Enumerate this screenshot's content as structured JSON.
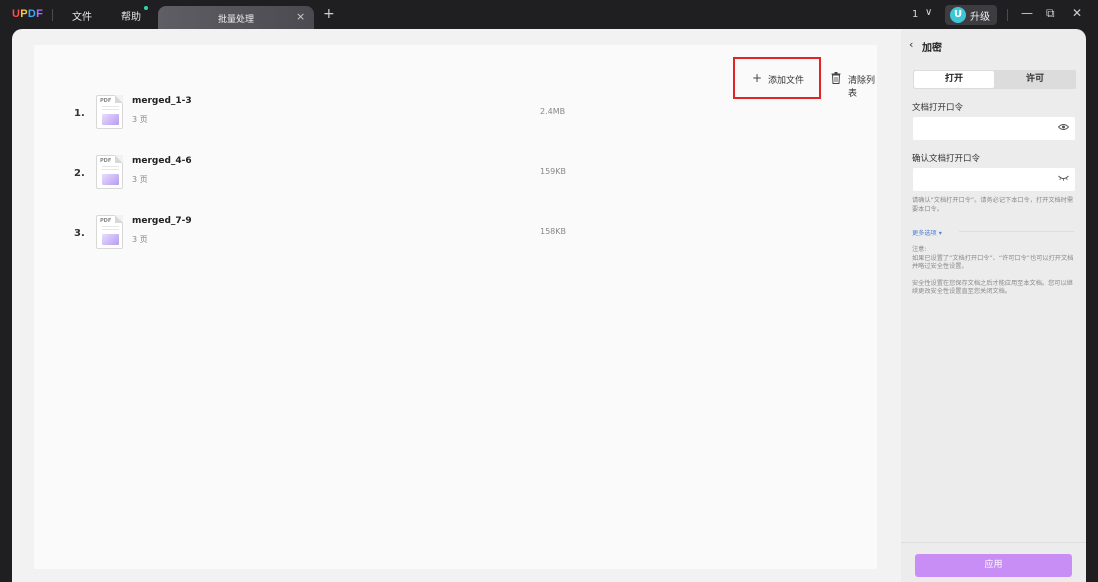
{
  "titlebar": {
    "logo": [
      "U",
      "P",
      "D",
      "F"
    ],
    "logo_colors": [
      "#ff4a4a",
      "#ffc53d",
      "#3fa9ff",
      "#b06cff"
    ],
    "menu_file": "文件",
    "menu_help": "帮助",
    "tab_title": "批量处理",
    "tab_close": "×",
    "tab_add": "+",
    "page_number": "1",
    "page_chevron": "∨",
    "upgrade_icon_letter": "U",
    "upgrade_label": "升级",
    "minimize": "—",
    "restore": "⧉",
    "close": "✕"
  },
  "toolbar": {
    "add_icon": "+",
    "add_label": "添加文件",
    "clear_label": "清除列表"
  },
  "files": [
    {
      "index": "1.",
      "name": "merged_1-3",
      "pages": "3 页",
      "size": "2.4MB"
    },
    {
      "index": "2.",
      "name": "merged_4-6",
      "pages": "3 页",
      "size": "159KB"
    },
    {
      "index": "3.",
      "name": "merged_7-9",
      "pages": "3 页",
      "size": "158KB"
    }
  ],
  "file_icon_text": "PDF",
  "side": {
    "back_icon": "‹",
    "title": "加密",
    "tab_open": "打开",
    "tab_permission": "许可",
    "open_password_label": "文档打开口令",
    "confirm_password_label": "确认文档打开口令",
    "eye_open": "👁",
    "eye_closed": "⌣",
    "hint": "请确认“文档打开口令”。请务必记下本口令，打开文档时需要本口令。",
    "more_options": "更多选项 ▾",
    "note_title": "注意:",
    "note_1": "如果已设置了“文档打开口令”、“许可口令”也可以打开文档并略过安全性设置。",
    "note_2": "安全性设置在您保存文档之后才能应用至本文档。您可以继续更改安全性设置直至您关闭文档。",
    "apply_label": "应用"
  },
  "colors": {
    "highlight_border": "#e02525",
    "apply_button": "#c88ef5",
    "upgrade_badge": "#3cc6d6",
    "help_dot": "#2fd6a3"
  }
}
